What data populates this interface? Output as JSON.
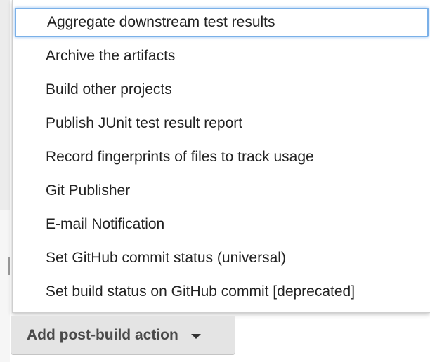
{
  "menu": {
    "items": [
      {
        "label": "Aggregate downstream test results",
        "selected": true
      },
      {
        "label": "Archive the artifacts",
        "selected": false
      },
      {
        "label": "Build other projects",
        "selected": false
      },
      {
        "label": "Publish JUnit test result report",
        "selected": false
      },
      {
        "label": "Record fingerprints of files to track usage",
        "selected": false
      },
      {
        "label": "Git Publisher",
        "selected": false
      },
      {
        "label": "E-mail Notification",
        "selected": false
      },
      {
        "label": "Set GitHub commit status (universal)",
        "selected": false
      },
      {
        "label": "Set build status on GitHub commit [deprecated]",
        "selected": false
      }
    ]
  },
  "button": {
    "label": "Add post-build action",
    "icon": "caret-down-icon"
  },
  "colors": {
    "focus_ring": "#7ab0e8",
    "button_bg": "#e4e4e4",
    "text": "#222222"
  }
}
